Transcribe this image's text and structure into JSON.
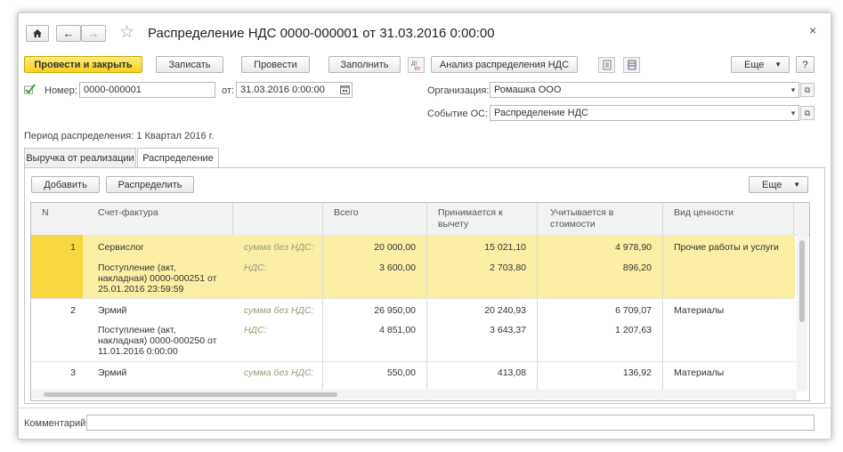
{
  "title": "Распределение НДС 0000-000001 от 31.03.2016 0:00:00",
  "toolbar": {
    "post_close": "Провести и закрыть",
    "save": "Записать",
    "post": "Провести",
    "fill": "Заполнить",
    "analysis": "Анализ распределения НДС",
    "more": "Еще",
    "help": "?"
  },
  "header": {
    "number_label": "Номер:",
    "number_value": "0000-000001",
    "date_label": "от:",
    "date_value": "31.03.2016  0:00:00",
    "org_label": "Организация:",
    "org_value": "Ромашка ООО",
    "event_label": "Событие ОС:",
    "event_value": "Распределение НДС",
    "period_text": "Период распределения: 1 Квартал 2016  г."
  },
  "tabs": [
    {
      "label": "Выручка от реализации",
      "active": false
    },
    {
      "label": "Распределение",
      "active": true
    }
  ],
  "grid_toolbar": {
    "add": "Добавить",
    "distribute": "Распределить",
    "more": "Еще"
  },
  "columns": [
    "N",
    "Счет-фактура",
    "",
    "Всего",
    "Принимается к вычету",
    "Учитывается в стоимости",
    "Вид ценности"
  ],
  "rows": [
    {
      "n": "1",
      "selected": true,
      "line1": {
        "doc": "Сервислог",
        "type": "сумма без НДС:",
        "total": "20 000,00",
        "deduct": "15 021,10",
        "cost": "4 978,90",
        "kind": "Прочие работы и услуги"
      },
      "line2": {
        "doc1": "Поступление (акт,",
        "doc2": "накладная) 0000-000251 от",
        "doc3": "25.01.2016 23:59:59",
        "type": "НДС:",
        "total": "3 600,00",
        "deduct": "2 703,80",
        "cost": "896,20"
      }
    },
    {
      "n": "2",
      "selected": false,
      "line1": {
        "doc": "Эрмий",
        "type": "сумма без НДС:",
        "total": "26 950,00",
        "deduct": "20 240,93",
        "cost": "6 709,07",
        "kind": "Материалы"
      },
      "line2": {
        "doc1": "Поступление (акт,",
        "doc2": "накладная) 0000-000250 от",
        "doc3": "11.01.2016 0:00:00",
        "type": "НДС:",
        "total": "4 851,00",
        "deduct": "3 643,37",
        "cost": "1 207,63"
      }
    },
    {
      "n": "3",
      "selected": false,
      "line1": {
        "doc": "Эрмий",
        "type": "сумма без НДС:",
        "total": "550,00",
        "deduct": "413,08",
        "cost": "136,92",
        "kind": "Материалы"
      }
    }
  ],
  "comment_label": "Комментарий:",
  "comment_value": ""
}
